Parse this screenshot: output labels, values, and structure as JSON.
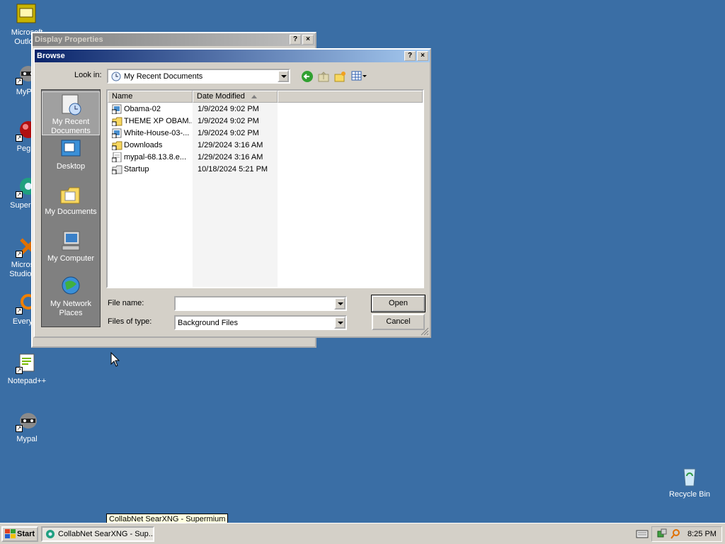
{
  "desktop": {
    "icons": [
      {
        "label": "Microsoft Outlo..."
      },
      {
        "label": "MyPal"
      },
      {
        "label": "Peg..."
      },
      {
        "label": "Superm..."
      },
      {
        "label": "Microsoft Studio 2..."
      },
      {
        "label": "Everyt..."
      },
      {
        "label": "Notepad++"
      },
      {
        "label": "Mypal"
      },
      {
        "label": "Recycle Bin"
      }
    ]
  },
  "display_properties": {
    "title": "Display Properties",
    "help": "?",
    "close": "×"
  },
  "browse": {
    "title": "Browse",
    "help": "?",
    "close": "×",
    "lookin_label": "Look in:",
    "lookin_value": "My Recent Documents",
    "places": [
      {
        "label": "My Recent Documents",
        "icon": "recent-documents-icon"
      },
      {
        "label": "Desktop",
        "icon": "desktop-icon"
      },
      {
        "label": "My Documents",
        "icon": "my-documents-icon"
      },
      {
        "label": "My Computer",
        "icon": "my-computer-icon"
      },
      {
        "label": "My Network Places",
        "icon": "network-places-icon"
      }
    ],
    "columns": {
      "name": "Name",
      "date": "Date Modified"
    },
    "files": [
      {
        "name": "Obama-02",
        "date": "1/9/2024 9:02 PM",
        "icon": "image-shortcut-icon"
      },
      {
        "name": "THEME XP OBAM...",
        "date": "1/9/2024 9:02 PM",
        "icon": "folder-shortcut-icon"
      },
      {
        "name": "White-House-03-...",
        "date": "1/9/2024 9:02 PM",
        "icon": "image-shortcut-icon"
      },
      {
        "name": "Downloads",
        "date": "1/29/2024 3:16 AM",
        "icon": "folder-shortcut-icon"
      },
      {
        "name": "mypal-68.13.8.e...",
        "date": "1/29/2024 3:16 AM",
        "icon": "file-shortcut-icon"
      },
      {
        "name": "Startup",
        "date": "10/18/2024 5:21 PM",
        "icon": "folder-shortcut-icon"
      }
    ],
    "filename_label": "File name:",
    "filename_value": "",
    "filetype_label": "Files of type:",
    "filetype_value": "Background Files",
    "open_label": "Open",
    "cancel_label": "Cancel"
  },
  "taskbar": {
    "start_label": "Start",
    "task_label": "CollabNet SearXNG - Sup...",
    "tooltip": "CollabNet SearXNG - Supermium",
    "clock": "8:25 PM"
  }
}
